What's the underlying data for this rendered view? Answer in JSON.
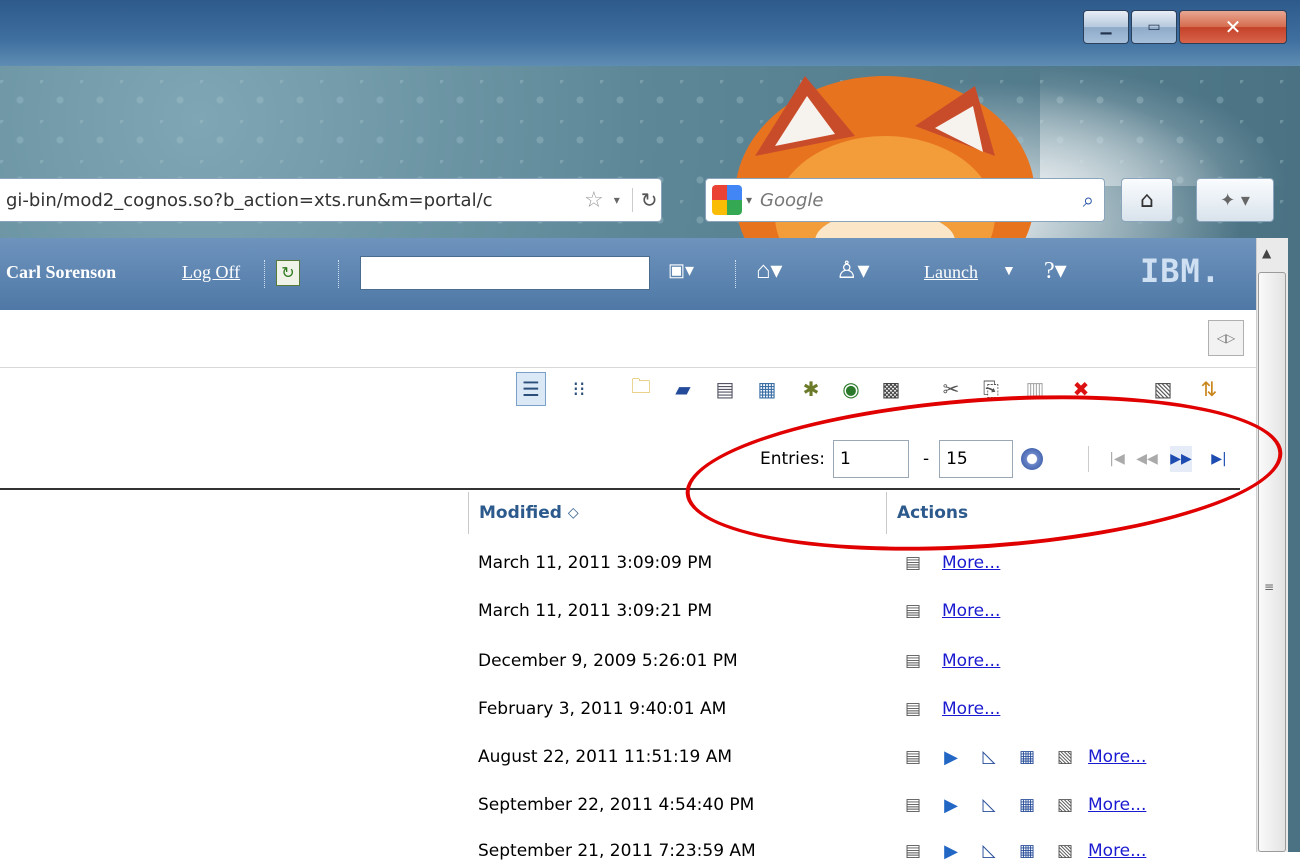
{
  "browser": {
    "url": "gi-bin/mod2_cognos.so?b_action=xts.run&m=portal/c",
    "search_engine": "Google",
    "search_placeholder": "Google"
  },
  "cognos": {
    "user_name": "Carl Sorenson",
    "log_off": "Log Off",
    "launch": "Launch",
    "brand": "IBM."
  },
  "list": {
    "entries_label": "Entries:",
    "entries_from": "1",
    "entries_dash": "-",
    "entries_to": "15",
    "columns": {
      "modified": "Modified",
      "actions": "Actions"
    },
    "rows": [
      {
        "modified": "March 11, 2011 3:09:09 PM",
        "more": "More...",
        "full_actions": false
      },
      {
        "modified": "March 11, 2011 3:09:21 PM",
        "more": "More...",
        "full_actions": false
      },
      {
        "modified": "December 9, 2009 5:26:01 PM",
        "more": "More...",
        "full_actions": false
      },
      {
        "modified": "February 3, 2011 9:40:01 AM",
        "more": "More...",
        "full_actions": false
      },
      {
        "modified": "August 22, 2011 11:51:19 AM",
        "more": "More...",
        "full_actions": true
      },
      {
        "modified": "September 22, 2011 4:54:40 PM",
        "more": "More...",
        "full_actions": true
      },
      {
        "modified": "September 21, 2011 7:23:59 AM",
        "more": "More...",
        "full_actions": true
      }
    ]
  },
  "colors": {
    "cognos_bar": "#5a83b0",
    "header_text": "#2c5a8c",
    "link": "#1a1ad0",
    "annotation": "#e00000"
  }
}
